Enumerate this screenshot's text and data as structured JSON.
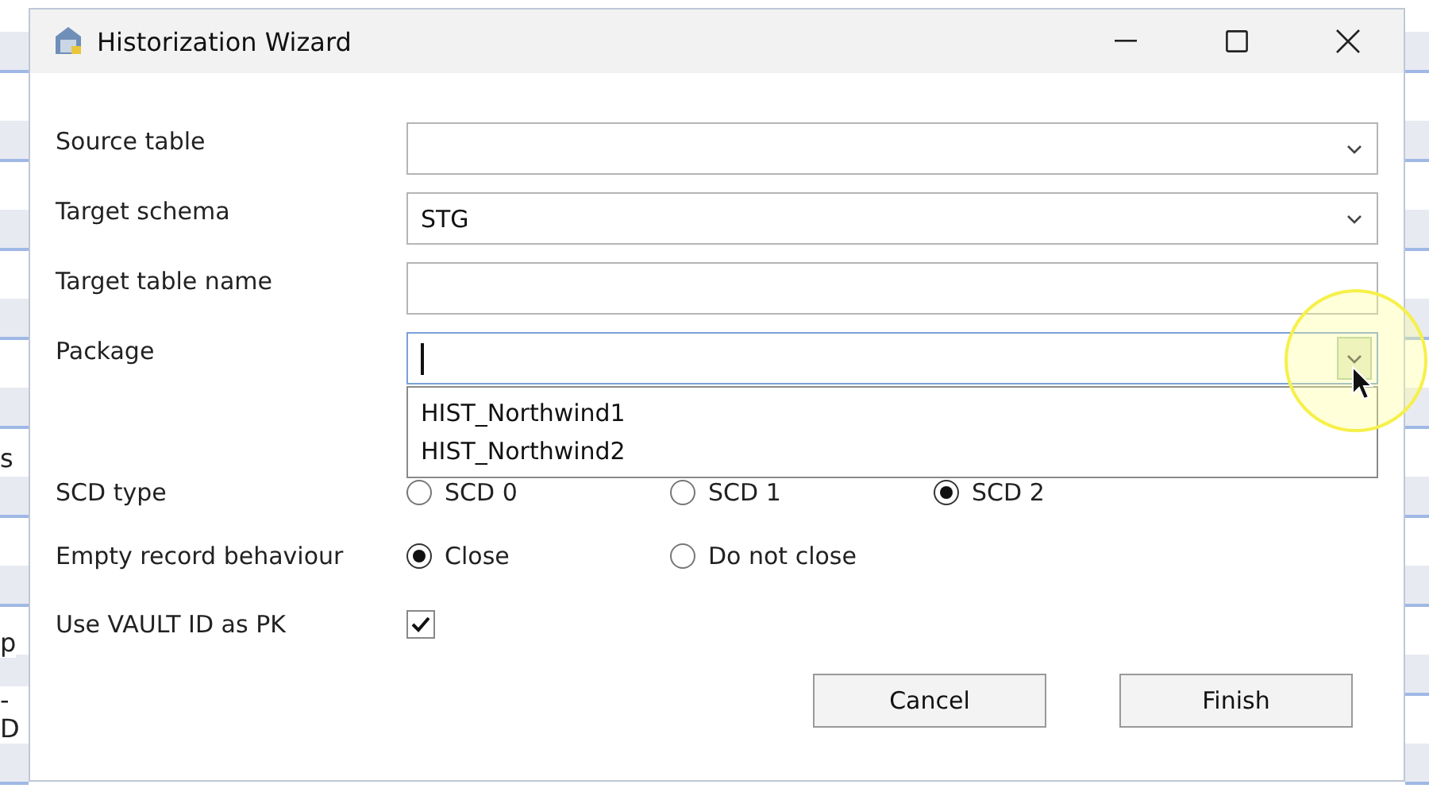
{
  "background_fragments": [
    "s",
    "p",
    "-D"
  ],
  "window": {
    "title": "Historization Wizard"
  },
  "fields": [
    {
      "kind": "combo",
      "label": "Source table"
    },
    {
      "kind": "combo",
      "label": "Target schema",
      "value": "STG"
    },
    {
      "kind": "text",
      "label": "Target table name"
    },
    {
      "kind": "combo",
      "label": "Package",
      "focused": true,
      "expanded": true,
      "options": [
        "HIST_Northwind1",
        "HIST_Northwind2"
      ]
    }
  ],
  "scd_type": {
    "label": "SCD type",
    "options": [
      {
        "label": "SCD 0",
        "selected": false
      },
      {
        "label": "SCD 1",
        "selected": false
      },
      {
        "label": "SCD 2",
        "selected": true
      }
    ]
  },
  "empty_record_behaviour": {
    "label": "Empty record behaviour",
    "options": [
      {
        "label": "Close",
        "selected": true
      },
      {
        "label": "Do not close",
        "selected": false
      }
    ]
  },
  "use_vault_id": {
    "label": "Use VAULT ID as PK",
    "checked": true
  },
  "buttons": [
    "Cancel",
    "Finish"
  ]
}
